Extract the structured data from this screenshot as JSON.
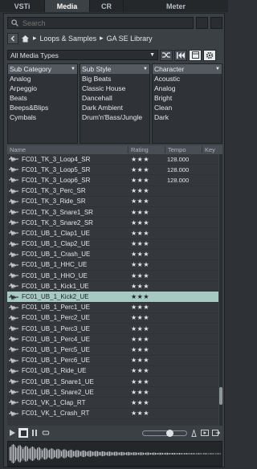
{
  "tabs": [
    {
      "label": "VSTi"
    },
    {
      "label": "Media"
    },
    {
      "label": "CR"
    },
    {
      "label": "Meter"
    }
  ],
  "search": {
    "placeholder": "Search"
  },
  "breadcrumb": {
    "items": [
      "Loops & Samples",
      "GA SE Library"
    ]
  },
  "filter": {
    "selected": "All Media Types"
  },
  "attributes": [
    {
      "header": "Sub Category",
      "items": [
        "Analog",
        "Arpeggio",
        "Beats",
        "Beeps&Blips",
        "Cymbals"
      ]
    },
    {
      "header": "Sub Style",
      "items": [
        "Big Beats",
        "Classic House",
        "Dancehall",
        "Dark Ambient",
        "Drum'n'Bass/Jungle"
      ]
    },
    {
      "header": "Character",
      "items": [
        "Acoustic",
        "Analog",
        "Bright",
        "Clean",
        "Dark"
      ]
    }
  ],
  "columns": {
    "name": "Name",
    "rating": "Rating",
    "tempo": "Tempo",
    "key": "Key"
  },
  "rows": [
    {
      "name": "FC01_TK_3_Loop4_SR",
      "rating": "★★★",
      "tempo": "128.000"
    },
    {
      "name": "FC01_TK_3_Loop5_SR",
      "rating": "★★★",
      "tempo": "128.000"
    },
    {
      "name": "FC01_TK_3_Loop6_SR",
      "rating": "★★★",
      "tempo": "128.000"
    },
    {
      "name": "FC01_TK_3_Perc_SR",
      "rating": "★★★",
      "tempo": ""
    },
    {
      "name": "FC01_TK_3_Ride_SR",
      "rating": "★★★",
      "tempo": ""
    },
    {
      "name": "FC01_TK_3_Snare1_SR",
      "rating": "★★★",
      "tempo": ""
    },
    {
      "name": "FC01_TK_3_Snare2_SR",
      "rating": "★★★",
      "tempo": ""
    },
    {
      "name": "FC01_UB_1_Clap1_UE",
      "rating": "★★★",
      "tempo": ""
    },
    {
      "name": "FC01_UB_1_Clap2_UE",
      "rating": "★★★",
      "tempo": ""
    },
    {
      "name": "FC01_UB_1_Crash_UE",
      "rating": "★★★",
      "tempo": ""
    },
    {
      "name": "FC01_UB_1_HHC_UE",
      "rating": "★★★",
      "tempo": ""
    },
    {
      "name": "FC01_UB_1_HHO_UE",
      "rating": "★★★",
      "tempo": ""
    },
    {
      "name": "FC01_UB_1_Kick1_UE",
      "rating": "★★★",
      "tempo": ""
    },
    {
      "name": "FC01_UB_1_Kick2_UE",
      "rating": "★★★",
      "tempo": "",
      "selected": true
    },
    {
      "name": "FC01_UB_1_Perc1_UE",
      "rating": "★★★",
      "tempo": ""
    },
    {
      "name": "FC01_UB_1_Perc2_UE",
      "rating": "★★★",
      "tempo": ""
    },
    {
      "name": "FC01_UB_1_Perc3_UE",
      "rating": "★★★",
      "tempo": ""
    },
    {
      "name": "FC01_UB_1_Perc4_UE",
      "rating": "★★★",
      "tempo": ""
    },
    {
      "name": "FC01_UB_1_Perc5_UE",
      "rating": "★★★",
      "tempo": ""
    },
    {
      "name": "FC01_UB_1_Perc6_UE",
      "rating": "★★★",
      "tempo": ""
    },
    {
      "name": "FC01_UB_1_Ride_UE",
      "rating": "★★★",
      "tempo": ""
    },
    {
      "name": "FC01_UB_1_Snare1_UE",
      "rating": "★★★",
      "tempo": ""
    },
    {
      "name": "FC01_UB_1_Snare2_UE",
      "rating": "★★★",
      "tempo": ""
    },
    {
      "name": "FC01_VK_1_Clap_RT",
      "rating": "★★★",
      "tempo": ""
    },
    {
      "name": "FC01_VK_1_Crash_RT",
      "rating": "★★★",
      "tempo": ""
    }
  ],
  "transport": {
    "volume_level": 0.62
  },
  "colors": {
    "selected_row": "#a6c9c2",
    "panel": "#3b4045",
    "header": "#545a60"
  }
}
